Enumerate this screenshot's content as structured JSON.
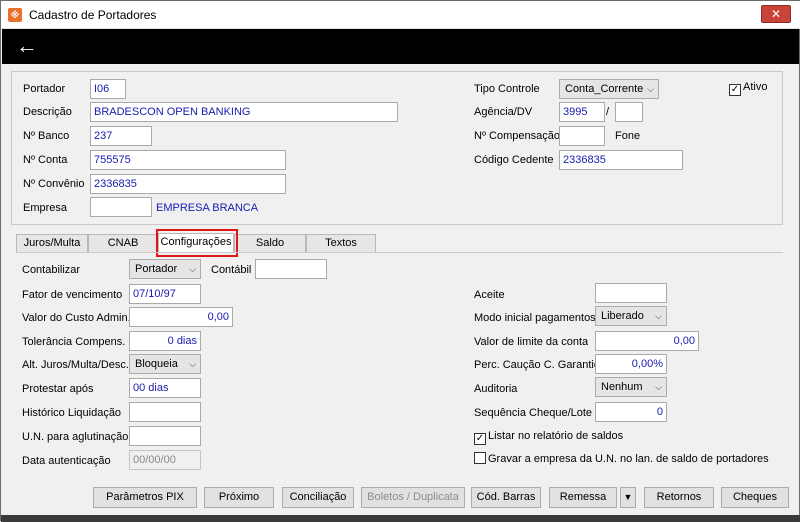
{
  "window": {
    "title": "Cadastro de Portadores",
    "close_label": "✕"
  },
  "nav": {
    "back_label": "←"
  },
  "header": {
    "portador_label": "Portador",
    "portador_value": "I06",
    "descricao_label": "Descrição",
    "descricao_value": "BRADESCON OPEN BANKING",
    "nbanco_label": "Nº Banco",
    "nbanco_value": "237",
    "nconta_label": "Nº Conta",
    "nconta_value": "755575",
    "nconvenio_label": "Nº Convênio",
    "nconvenio_value": "2336835",
    "empresa_label": "Empresa",
    "empresa_value": "",
    "empresa_name": "EMPRESA BRANCA",
    "tipo_controle_label": "Tipo Controle",
    "tipo_controle_value": "Conta_Corrente",
    "ativo_label": "Ativo",
    "ativo_checked": "✓",
    "agencia_label": "Agência/DV",
    "agencia_value": "3995",
    "agencia_sep": "/",
    "agencia_dv": "",
    "ncompensacao_label": "Nº Compensação",
    "ncompensacao_value": "",
    "fone_label": "Fone",
    "codigo_cedente_label": "Código Cedente",
    "codigo_cedente_value": "2336835"
  },
  "tabs": [
    "Juros/Multa",
    "CNAB",
    "Configurações",
    "Saldo",
    "Textos"
  ],
  "config": {
    "contabilizar_label": "Contabilizar",
    "contabilizar_value": "Portador",
    "contabil_label": "Contábil",
    "contabil_value": "",
    "fator_label": "Fator de vencimento",
    "fator_value": "07/10/97",
    "custo_label": "Valor do Custo Admin.",
    "custo_value": "0,00",
    "tolerancia_label": "Tolerância Compens.",
    "tolerancia_value": "0 dias",
    "alt_juros_label": "Alt. Juros/Multa/Desc.",
    "alt_juros_value": "Bloqueia",
    "protestar_label": "Protestar após",
    "protestar_value": "00 dias",
    "historico_label": "Histórico Liquidação",
    "historico_value": "",
    "un_label": "U.N. para aglutinação",
    "un_value": "",
    "data_aut_label": "Data autenticação",
    "data_aut_value": "00/00/00",
    "aceite_label": "Aceite",
    "aceite_value": "",
    "modo_label": "Modo inicial pagamentos",
    "modo_value": "Liberado",
    "limite_label": "Valor de limite da conta",
    "limite_value": "0,00",
    "caucao_label": "Perc. Caução C. Garantida",
    "caucao_value": "0,00%",
    "auditoria_label": "Auditoria",
    "auditoria_value": "Nenhum",
    "sequencia_label": "Sequência Cheque/Lote",
    "sequencia_value": "0",
    "listar_label": "Listar no relatório de saldos",
    "listar_checked": "✓",
    "gravar_label": "Gravar a empresa da U.N. no lan. de saldo de portadores",
    "gravar_checked": ""
  },
  "buttons": {
    "parametros_pix": "Parâmetros PIX",
    "proximo": "Próximo",
    "conciliacao": "Conciliação",
    "boletos": "Boletos / Duplicata",
    "cod_barras": "Cód. Barras",
    "remessa": "Remessa",
    "remessa_drop": "▼",
    "retornos": "Retornos",
    "cheques": "Cheques"
  }
}
